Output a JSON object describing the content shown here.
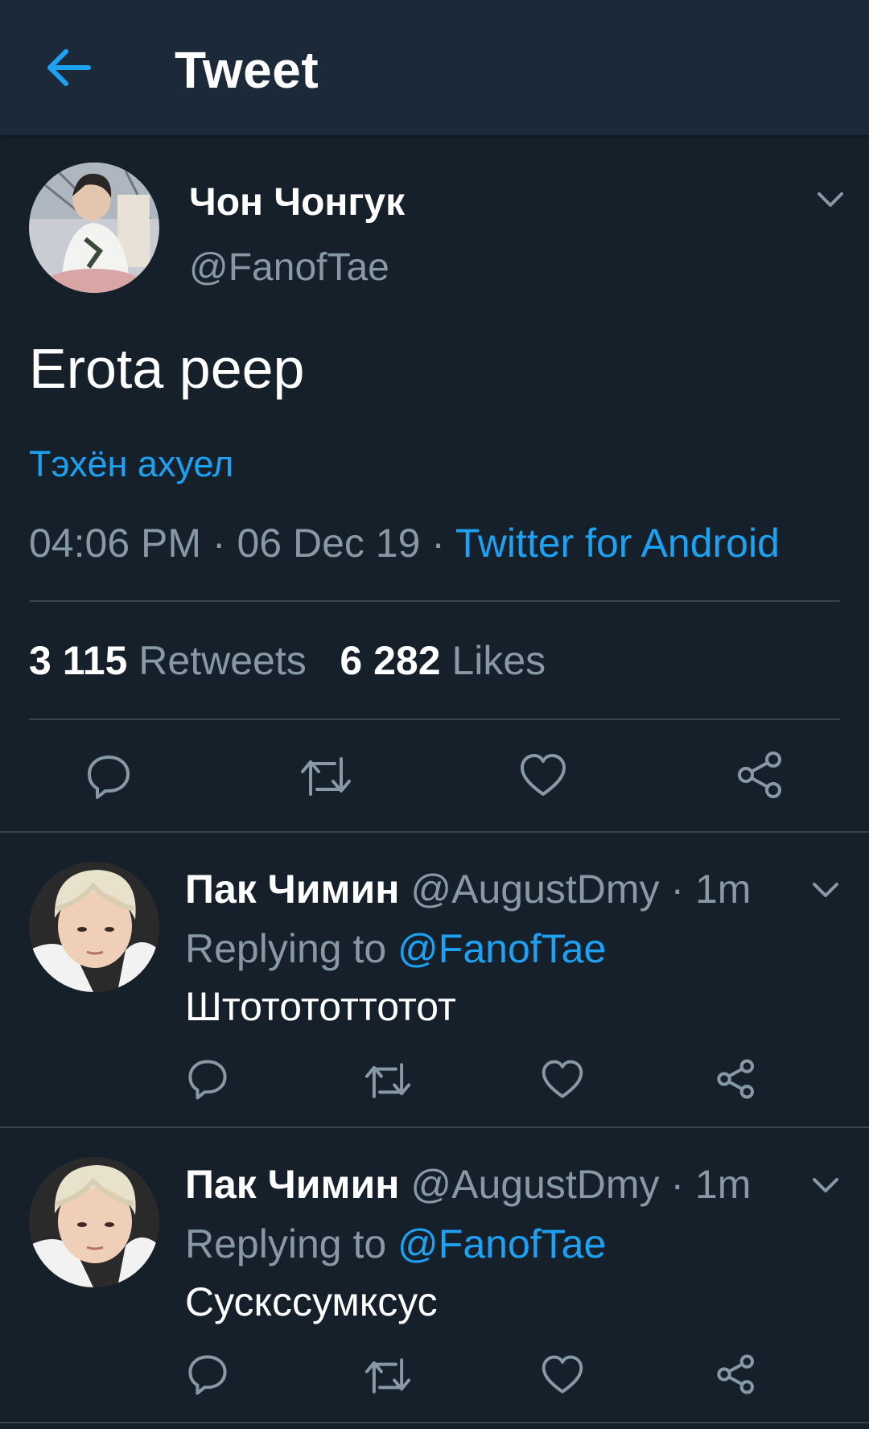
{
  "header": {
    "title": "Tweet",
    "back_icon": "arrow-left-icon",
    "accent": "#1da1f2"
  },
  "tweet": {
    "author_name": "Чон Чонгук",
    "author_handle": "@FanofTae",
    "text": "Erota peep",
    "translation": "Тэхён ахуел",
    "time": "04:06 PM",
    "sep1": " · ",
    "date": "06 Dec 19",
    "sep2": " · ",
    "source": "Twitter for Android",
    "retweets_count": "3 115",
    "retweets_label": "Retweets",
    "likes_count": "6 282",
    "likes_label": "Likes"
  },
  "replies": [
    {
      "author_name": "Пак Чимин",
      "author_handle": "@AugustDmy",
      "sep": " · ",
      "time": "1m",
      "replying_label": "Replying to ",
      "replying_handle": "@FanofTae",
      "text": "Штотототтотот"
    },
    {
      "author_name": "Пак Чимин",
      "author_handle": "@AugustDmy",
      "sep": " · ",
      "time": "1m",
      "replying_label": "Replying to ",
      "replying_handle": "@FanofTae",
      "text": "Сускссумксус"
    }
  ],
  "colors": {
    "background": "#15202b",
    "bar": "#1c2938",
    "muted": "#8899a6",
    "divider": "#38444d"
  }
}
